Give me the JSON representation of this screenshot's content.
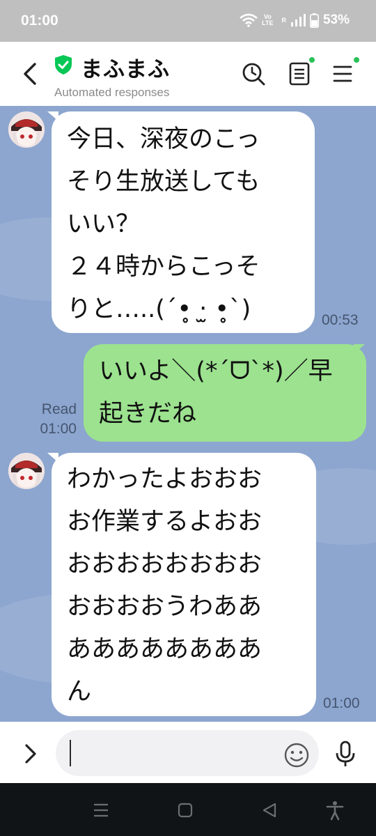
{
  "status_bar": {
    "time": "01:00",
    "volte_top": "Vo",
    "volte_bottom": "LTE",
    "roaming": "R",
    "battery": "53%"
  },
  "header": {
    "title": "まふまふ",
    "subtitle": "Automated responses",
    "accent_color": "#06c755",
    "icons": [
      "back-icon",
      "verified-shield-icon",
      "history-search-icon",
      "notes-icon",
      "menu-icon"
    ]
  },
  "messages": [
    {
      "direction": "incoming",
      "lines": [
        "今日、深夜のこっ",
        "そり生放送しても",
        "いい？",
        "２４時からこっそ",
        "りと…..(´•̥ ‧̫ •̥`)"
      ],
      "time": "00:53"
    },
    {
      "direction": "outgoing",
      "lines": [
        "いいよ＼(*´ᗜ`*)／早",
        "起きだね"
      ],
      "status": "Read",
      "time": "01:00"
    },
    {
      "direction": "incoming",
      "lines": [
        "わかったよおおお",
        "お作業するよおお",
        "おおおおおおおお",
        "おおおおうわああ",
        "ああああああああ",
        "ん"
      ],
      "time": "01:00"
    }
  ],
  "composer": {
    "placeholder": ""
  },
  "colors": {
    "chat_background": "#8da6cf",
    "incoming_bubble": "#ffffff",
    "outgoing_bubble": "#9ce28f"
  }
}
